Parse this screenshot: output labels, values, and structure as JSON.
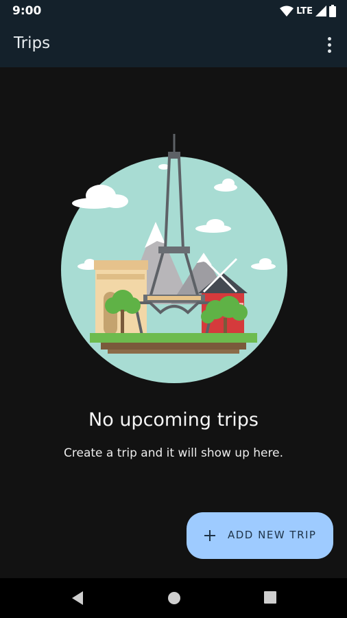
{
  "status_bar": {
    "time": "9:00",
    "network": "LTE",
    "icons": [
      "wifi-icon",
      "signal-icon",
      "battery-icon"
    ]
  },
  "app_bar": {
    "title": "Trips",
    "menu_icon": "more-vert-icon"
  },
  "empty_state": {
    "illustration": "paris-landmarks-illustration",
    "title": "No upcoming trips",
    "subtitle": "Create a trip and it will show up here."
  },
  "fab": {
    "icon": "plus-icon",
    "label": "ADD NEW TRIP",
    "color": "#9ecbff"
  },
  "nav_bar": {
    "icons": [
      "back-icon",
      "home-icon",
      "recents-icon"
    ]
  },
  "colors": {
    "background": "#121212",
    "app_bar": "#14212b",
    "accent": "#9ecbff"
  }
}
